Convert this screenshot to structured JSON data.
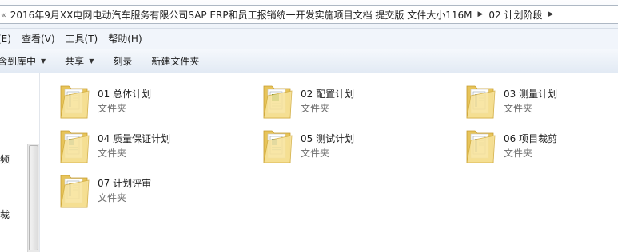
{
  "address_bar": {
    "lead_glyph": "«",
    "crumbs": [
      "2016年9月XX电网电动汽车服务有限公司SAP ERP和员工报销统一开发实施项目文档 提交版 文件大小116M",
      "02 计划阶段"
    ],
    "separator": "▶"
  },
  "menu": [
    "(E)",
    "查看(V)",
    "工具(T)",
    "帮助(H)"
  ],
  "toolbar": {
    "include_in_library": "含到库中",
    "share": "共享",
    "burn": "刻录",
    "new_folder": "新建文件夹"
  },
  "nav": {
    "labels": [
      "频",
      "裁"
    ]
  },
  "folders": [
    {
      "name": "01 总体计划",
      "type": "文件夹",
      "preview": "doc"
    },
    {
      "name": "02 配置计划",
      "type": "文件夹",
      "preview": "xls"
    },
    {
      "name": "03 测量计划",
      "type": "文件夹",
      "preview": "doc"
    },
    {
      "name": "04 质量保证计划",
      "type": "文件夹",
      "preview": "chart"
    },
    {
      "name": "05 测试计划",
      "type": "文件夹",
      "preview": "chart"
    },
    {
      "name": "06 项目裁剪",
      "type": "文件夹",
      "preview": "doc"
    },
    {
      "name": "07 计划评审",
      "type": "文件夹",
      "preview": "doc"
    }
  ],
  "colors": {
    "folder_back": "#e7c45a",
    "folder_front": "#f8e39a",
    "xls_accent": "#2f8a3c",
    "doc_accent": "#3c6fb0"
  }
}
